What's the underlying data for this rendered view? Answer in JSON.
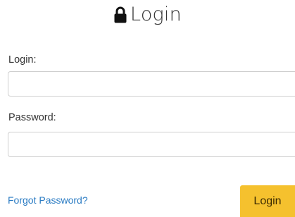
{
  "header": {
    "icon": "lock-icon",
    "title": "Login"
  },
  "form": {
    "login_label": "Login:",
    "login_value": "",
    "password_label": "Password:",
    "password_value": ""
  },
  "footer": {
    "forgot_link": "Forgot Password?",
    "login_button": "Login"
  },
  "colors": {
    "button": "#f5c12e",
    "link": "#2a7bc3"
  }
}
